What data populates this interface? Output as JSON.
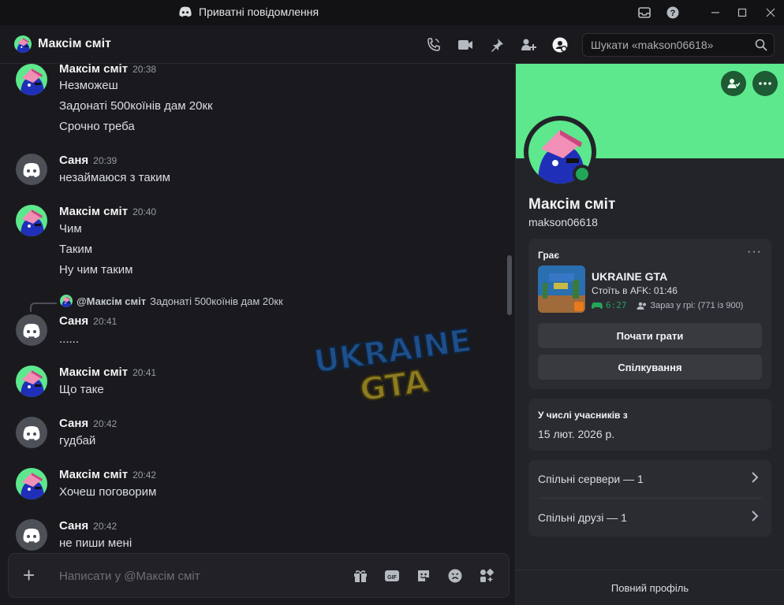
{
  "window": {
    "title": "Приватні повідомлення"
  },
  "header": {
    "name": "Максім сміт",
    "search_placeholder": "Шукати «makson06618»"
  },
  "messages": [
    {
      "author": "Максім сміт",
      "time": "20:38",
      "avatar": "maxim",
      "lines": [
        "Незможеш",
        "Задонаті 500коїнів дам 20кк",
        "Срочно треба"
      ]
    },
    {
      "author": "Саня",
      "time": "20:39",
      "avatar": "discord",
      "lines": [
        "незаймаюся з таким"
      ]
    },
    {
      "author": "Максім сміт",
      "time": "20:40",
      "avatar": "maxim",
      "lines": [
        "Чим",
        "Таким",
        "Ну чим таким"
      ]
    },
    {
      "author": "Саня",
      "time": "20:41",
      "avatar": "discord",
      "lines": [
        "......"
      ],
      "reply": {
        "to": "@Максім сміт",
        "text": "Задонаті 500коїнів дам 20кк"
      }
    },
    {
      "author": "Максім сміт",
      "time": "20:41",
      "avatar": "maxim",
      "lines": [
        "Що таке"
      ]
    },
    {
      "author": "Саня",
      "time": "20:42",
      "avatar": "discord",
      "lines": [
        "гудбай"
      ]
    },
    {
      "author": "Максім сміт",
      "time": "20:42",
      "avatar": "maxim",
      "lines": [
        "Хочеш поговорим"
      ]
    },
    {
      "author": "Саня",
      "time": "20:42",
      "avatar": "discord",
      "lines": [
        "не пиши мені"
      ]
    }
  ],
  "composer": {
    "placeholder": "Написати у @Максім сміт"
  },
  "profile": {
    "display_name": "Максім сміт",
    "username": "makson06618",
    "banner_color": "#5de88d",
    "activity": {
      "label": "Грає",
      "game": "UKRAINE GTA",
      "status": "Стоїть в AFK: 01:46",
      "elapsed": "6:27",
      "party": "Зараз у грі: (771 із 900)",
      "play_button": "Почати грати",
      "chat_button": "Спілкування"
    },
    "member_since_label": "У числі учасників з",
    "member_since": "15 лют. 2026 р.",
    "mutual_servers": "Спільні сервери — 1",
    "mutual_friends": "Спільні друзі — 1",
    "full_profile": "Повний профіль"
  },
  "watermark": {
    "line1": "UKRAINE",
    "line2": "GTA"
  }
}
